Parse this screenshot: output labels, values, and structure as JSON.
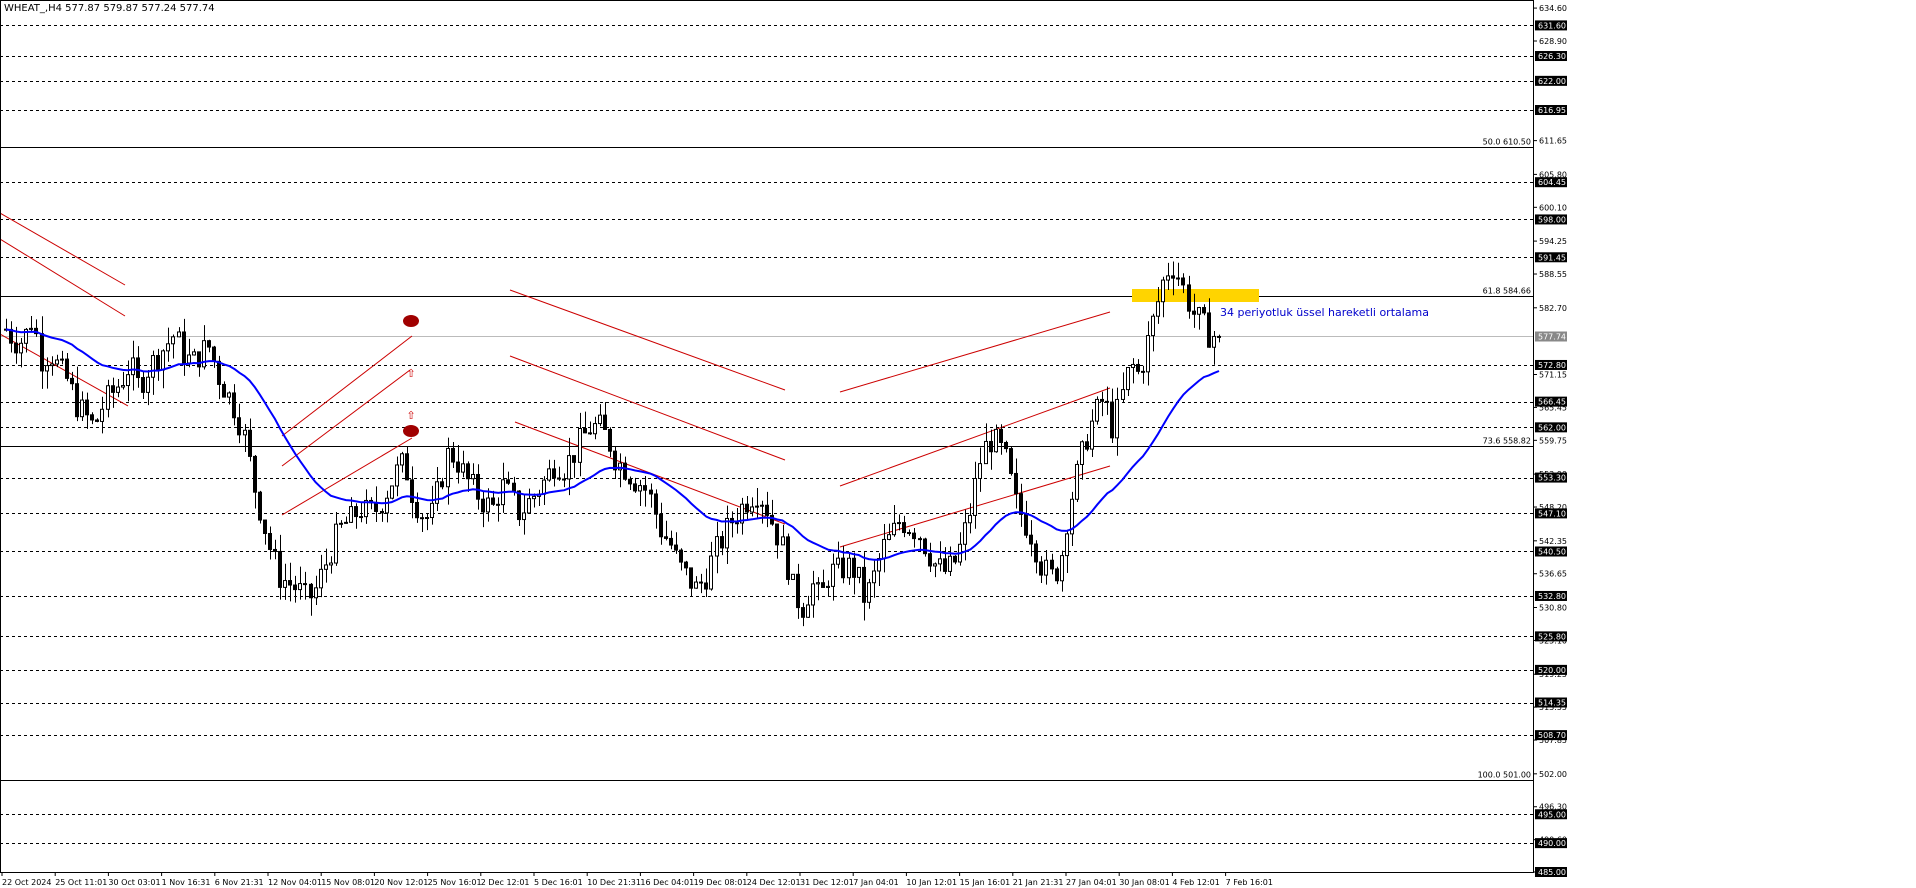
{
  "header": {
    "symbol": "WHEAT_,H4",
    "ohlc": "577.87 579.87 577.24 577.74"
  },
  "colors": {
    "background": "#ffffff",
    "candle": "#000000",
    "ema": "#0000ff",
    "channel": "#cc0000",
    "highlight_zone": "#ffd400",
    "fib_line": "#000000",
    "level_line": "#000000",
    "marker_ellipse": "#a00000",
    "arrow": "#cc0000",
    "annotation_text": "#0000cc",
    "price_badge_bg": "#000000",
    "price_badge_text": "#ffffff"
  },
  "chart_data": {
    "type": "candlestick",
    "title": "WHEAT_,H4",
    "ylim": [
      485.0,
      636.0
    ],
    "x_tick_labels": [
      "22 Oct 2024",
      "25 Oct 11:01",
      "30 Oct 03:01",
      "1 Nov 16:31",
      "6 Nov 21:31",
      "12 Nov 04:01",
      "15 Nov 08:01",
      "20 Nov 12:01",
      "25 Nov 16:01",
      "2 Dec 12:01",
      "5 Dec 16:01",
      "10 Dec 21:31",
      "16 Dec 04:01",
      "19 Dec 08:01",
      "24 Dec 12:01",
      "31 Dec 12:01",
      "7 Jan 04:01",
      "10 Jan 12:01",
      "15 Jan 16:01",
      "21 Jan 21:31",
      "27 Jan 04:01",
      "30 Jan 08:01",
      "4 Feb 12:01",
      "7 Feb 16:01"
    ],
    "y_tick_labels": [
      "634.60",
      "628.90",
      "611.65",
      "605.80",
      "600.10",
      "594.25",
      "588.55",
      "582.70",
      "571.15",
      "565.45",
      "559.75",
      "553.90",
      "548.20",
      "542.35",
      "536.65",
      "530.80",
      "525.10",
      "519.25",
      "513.55",
      "507.85",
      "502.00",
      "496.30",
      "490.60",
      "485.00"
    ],
    "dashed_levels": [
      631.6,
      626.3,
      622.0,
      616.95,
      604.45,
      598.0,
      591.45,
      572.8,
      566.45,
      562.0,
      553.3,
      547.1,
      540.5,
      532.8,
      525.8,
      520.0,
      514.35,
      508.7,
      495.0,
      490.0,
      485.0
    ],
    "current_price": 577.74,
    "fibonacci_levels": [
      {
        "label": "50.0 610.50",
        "value": 610.5
      },
      {
        "label": "61.8 584.66",
        "value": 584.66
      },
      {
        "label": "73.6 558.82",
        "value": 558.82
      },
      {
        "label": "100.0 501.00",
        "value": 501.0
      }
    ],
    "close_path": [
      579,
      577,
      577,
      581,
      574,
      575,
      572,
      570,
      566,
      564,
      562,
      566,
      568,
      570,
      573,
      569,
      572,
      574,
      576,
      578,
      575,
      573,
      575,
      576,
      571,
      568,
      565,
      560,
      552,
      546,
      540,
      536,
      535,
      534,
      532,
      534,
      538,
      542,
      545,
      546,
      548,
      547,
      548,
      551,
      554,
      556,
      550,
      547,
      546,
      552,
      558,
      556,
      553,
      551,
      549,
      548,
      552,
      550,
      547,
      549,
      551,
      553,
      556,
      555,
      557,
      560,
      562,
      562,
      560,
      556,
      555,
      553,
      552,
      549,
      544,
      542,
      538,
      536,
      534,
      536,
      540,
      543,
      546,
      548,
      550,
      551,
      548,
      544,
      540,
      533,
      531,
      535,
      532,
      537,
      537,
      538,
      537,
      532,
      536,
      541,
      543,
      546,
      545,
      544,
      541,
      538,
      537,
      538,
      542,
      548,
      556,
      560,
      559,
      556,
      549,
      546,
      543,
      538,
      536,
      538,
      548,
      554,
      560,
      564,
      567,
      562,
      567,
      573,
      571,
      577,
      583,
      589,
      590,
      586,
      582,
      580,
      578,
      577.74
    ],
    "ema_label": "34 periyotluk üssel hareketli ortalama"
  }
}
